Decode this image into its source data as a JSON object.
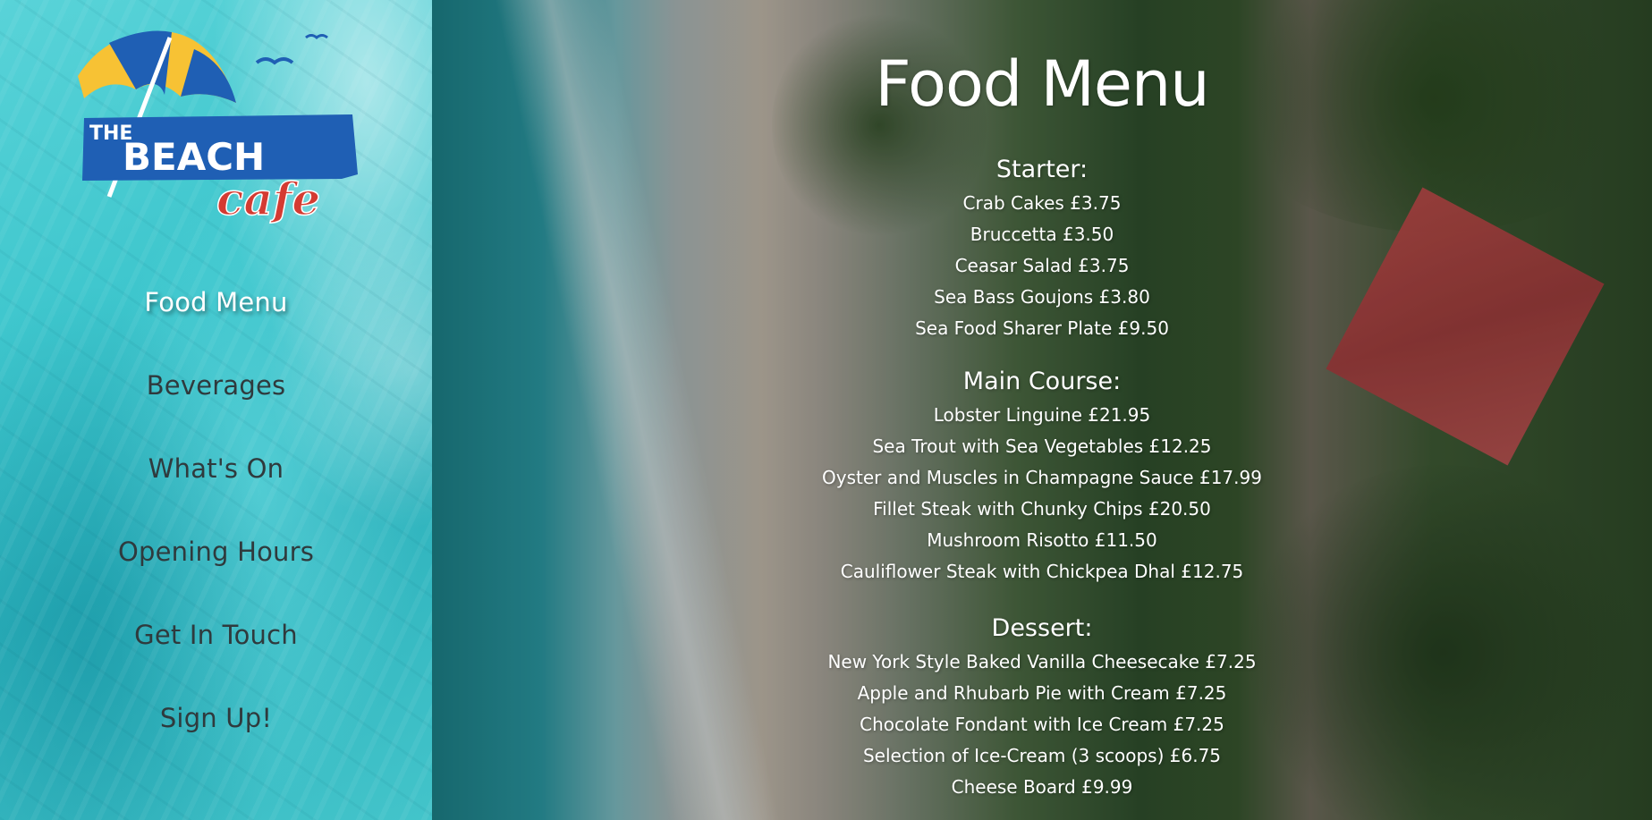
{
  "sidebar": {
    "logo": {
      "line1": "THE",
      "line2": "BEACH",
      "line3": "cafe"
    },
    "nav": [
      {
        "label": "Food Menu",
        "active": true
      },
      {
        "label": "Beverages",
        "active": false
      },
      {
        "label": "What's On",
        "active": false
      },
      {
        "label": "Opening Hours",
        "active": false
      },
      {
        "label": "Get In Touch",
        "active": false
      },
      {
        "label": "Sign Up!",
        "active": false
      }
    ]
  },
  "main": {
    "title": "Food Menu",
    "sections": [
      {
        "heading": "Starter:",
        "items": [
          "Crab Cakes £3.75",
          "Bruccetta £3.50",
          "Ceasar Salad £3.75",
          "Sea Bass Goujons £3.80",
          "Sea Food Sharer Plate £9.50"
        ]
      },
      {
        "heading": "Main Course:",
        "items": [
          "Lobster Linguine £21.95",
          "Sea Trout with Sea Vegetables £12.25",
          "Oyster and Muscles in Champagne Sauce £17.99",
          "Fillet Steak with Chunky Chips £20.50",
          "Mushroom Risotto £11.50",
          "Cauliflower Steak with Chickpea Dhal £12.75"
        ]
      },
      {
        "heading": "Dessert:",
        "items": [
          "New York Style Baked Vanilla Cheesecake £7.25",
          "Apple and Rhubarb Pie with Cream £7.25",
          "Chocolate Fondant with Ice Cream £7.25",
          "Selection of Ice-Cream (3 scoops) £6.75",
          "Cheese Board £9.99"
        ]
      }
    ]
  },
  "colors": {
    "logo_blue": "#1f5fb4",
    "logo_yellow": "#f7c234",
    "logo_red": "#d43b32",
    "nav_text": "#2f3a3d",
    "nav_active": "#ffffff"
  }
}
